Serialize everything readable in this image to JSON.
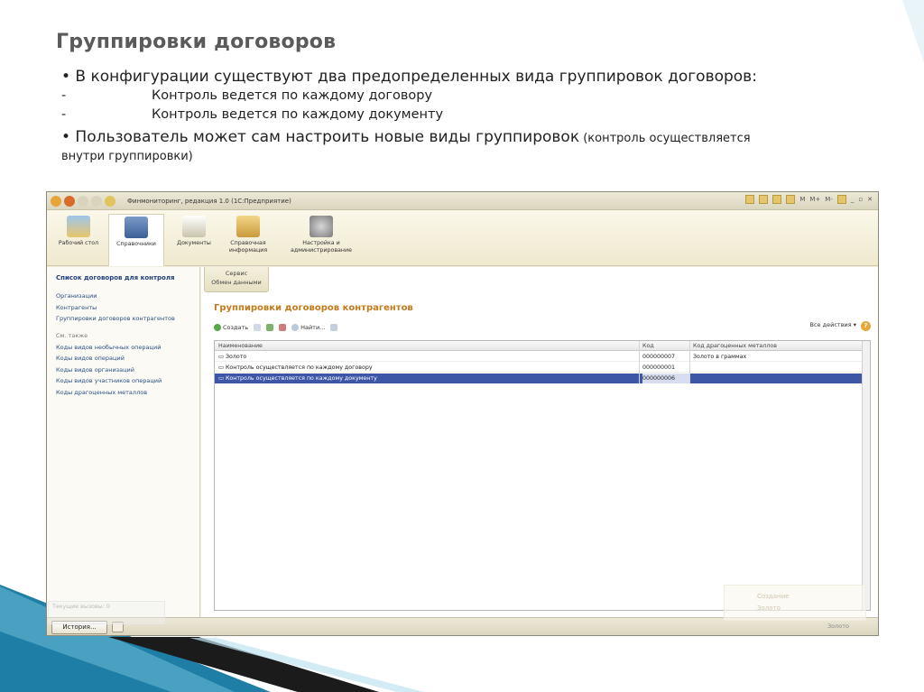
{
  "slide": {
    "title": "Группировки договоров",
    "bullet1": "• В конфигурации существуют два предопределенных вида группировок договоров:",
    "sub_items": [
      {
        "dash": "-",
        "text": "Контроль ведется по каждому договору"
      },
      {
        "dash": "-",
        "text": "Контроль ведется по каждому документу"
      }
    ],
    "bullet2_main": "• Пользователь может сам настроить новые виды группировок",
    "bullet2_note": " (контроль осуществляется",
    "bullet2_cont": "внутри группировки)"
  },
  "app": {
    "title": "Финмониторинг, редакция 1.0  (1С:Предприятие)",
    "ribbon": [
      {
        "label": "Рабочий стол",
        "icon": "desktop-icon",
        "active": false
      },
      {
        "label": "Справочники",
        "icon": "people-icon",
        "active": true
      },
      {
        "label": "Документы",
        "icon": "clipboard-icon",
        "active": false
      },
      {
        "label": "Справочная информация",
        "icon": "folder-icon",
        "active": false
      },
      {
        "label": "Настройка и администрирование",
        "icon": "gear-icon",
        "active": false
      }
    ],
    "service_tab": {
      "line1": "Сервис",
      "line2": "Обмен данными"
    },
    "sidebar": {
      "heading": "Список договоров для контроля",
      "links": [
        "Организации",
        "Контрагенты",
        "Группировки договоров контрагентов"
      ],
      "see_also": "См. также",
      "see_links": [
        "Коды видов необычных операций",
        "Коды видов операций",
        "Коды видов организаций",
        "Коды видов участников операций",
        "Коды драгоценных металлов"
      ]
    },
    "form": {
      "title": "Группировки договоров контрагентов",
      "toolbar": {
        "create": "Создать",
        "find": "Найти...",
        "all_actions": "Все действия ▾",
        "help": "?"
      },
      "columns": [
        "Наименование",
        "Код",
        "Код драгоценных металлов"
      ],
      "rows": [
        {
          "name": "Золото",
          "code": "000000007",
          "metal": "Золото в граммах"
        },
        {
          "name": "Контроль осуществляется по каждому договору",
          "code": "000000001",
          "metal": ""
        },
        {
          "name": "Контроль осуществляется по каждому документу",
          "code": "000000006",
          "metal": ""
        }
      ]
    },
    "status": {
      "history_button": "История...",
      "right_text": "Золото"
    },
    "ghost_left": "Текущие вызовы: 0",
    "ghost_right": {
      "line1": "Создание",
      "line2": "Золото"
    }
  },
  "colors": {
    "title_text": "#5a5a5a",
    "form_title": "#c17b1a",
    "link": "#2b4f86",
    "selected_row": "#3d56a6",
    "deco_teal": "#2a7f9e",
    "deco_dark": "#1c1c1c"
  }
}
